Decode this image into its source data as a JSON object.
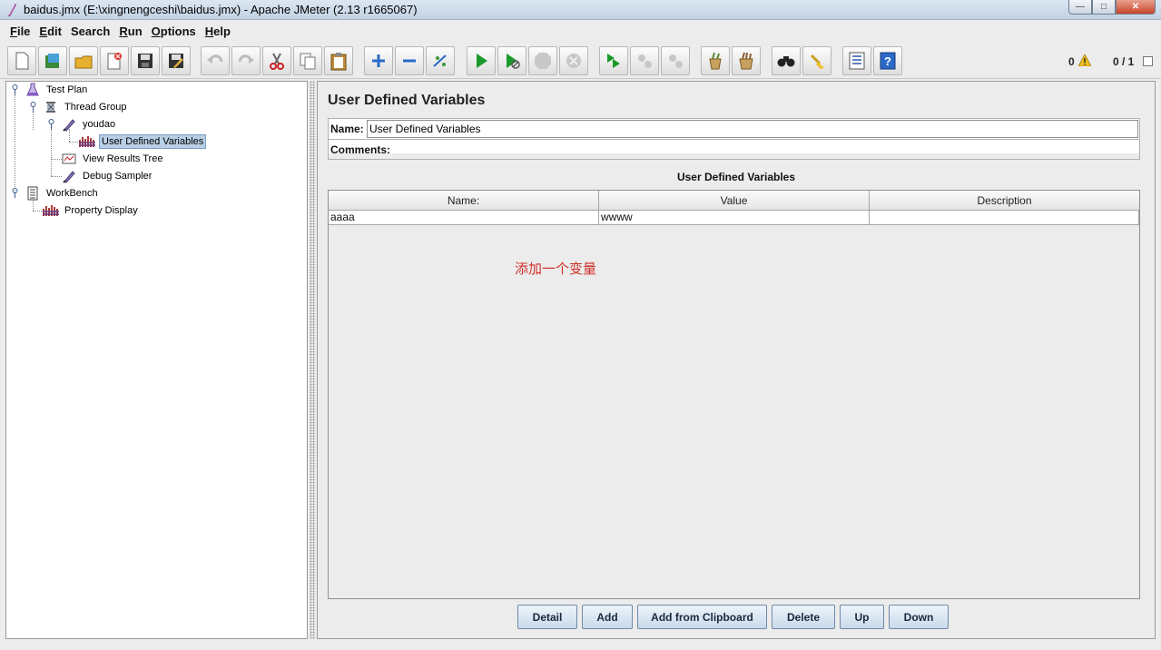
{
  "window": {
    "title": "baidus.jmx (E:\\xingnengceshi\\baidus.jmx) - Apache JMeter (2.13 r1665067)"
  },
  "menu": [
    {
      "label": "File",
      "mnemonic": "F",
      "rest": "ile"
    },
    {
      "label": "Edit",
      "mnemonic": "E",
      "rest": "dit"
    },
    {
      "label": "Search",
      "mnemonic": "",
      "rest": "Search"
    },
    {
      "label": "Run",
      "mnemonic": "R",
      "rest": "un"
    },
    {
      "label": "Options",
      "mnemonic": "O",
      "rest": "ptions"
    },
    {
      "label": "Help",
      "mnemonic": "H",
      "rest": "elp"
    }
  ],
  "toolbar": {
    "icons": [
      "new-icon",
      "templates-icon",
      "open-icon",
      "close-icon",
      "save-icon",
      "save-as-icon",
      "undo-icon",
      "redo-icon",
      "cut-icon",
      "copy-icon",
      "paste-icon",
      "expand-icon",
      "collapse-icon",
      "toggle-icon",
      "start-icon",
      "start-no-pause-icon",
      "stop-icon",
      "shutdown-icon",
      "remote-start-icon",
      "remote-stop-icon",
      "remote-shutdown-icon",
      "clear-icon",
      "clear-all-icon",
      "search-icon",
      "reset-search-icon",
      "function-helper-icon",
      "help-icon"
    ],
    "warning_count": "0",
    "thread_count": "0 / 1"
  },
  "tree": {
    "nodes": [
      {
        "label": "Test Plan",
        "icon": "test-plan-icon"
      },
      {
        "label": "Thread Group",
        "icon": "thread-group-icon"
      },
      {
        "label": "youdao",
        "icon": "sampler-icon"
      },
      {
        "label": "User Defined Variables",
        "icon": "config-element-icon",
        "selected": true
      },
      {
        "label": "View Results Tree",
        "icon": "listener-icon"
      },
      {
        "label": "Debug Sampler",
        "icon": "sampler-icon"
      },
      {
        "label": "WorkBench",
        "icon": "workbench-icon"
      },
      {
        "label": "Property Display",
        "icon": "config-element-icon"
      }
    ]
  },
  "editor": {
    "panel_title": "User Defined Variables",
    "name_label": "Name:",
    "name_value": "User Defined Variables",
    "comments_label": "Comments:",
    "table_title": "User Defined Variables",
    "columns": [
      "Name:",
      "Value",
      "Description"
    ],
    "rows": [
      {
        "name": "aaaa",
        "value": "wwww",
        "description": ""
      }
    ],
    "annotation": "添加一个变量"
  },
  "buttons": {
    "detail": "Detail",
    "add": "Add",
    "add_clipboard": "Add from Clipboard",
    "delete": "Delete",
    "up": "Up",
    "down": "Down"
  },
  "colors": {
    "selection": "#b8cfe5",
    "annotation": "#d0302a",
    "button_border": "#6f8aa8"
  }
}
